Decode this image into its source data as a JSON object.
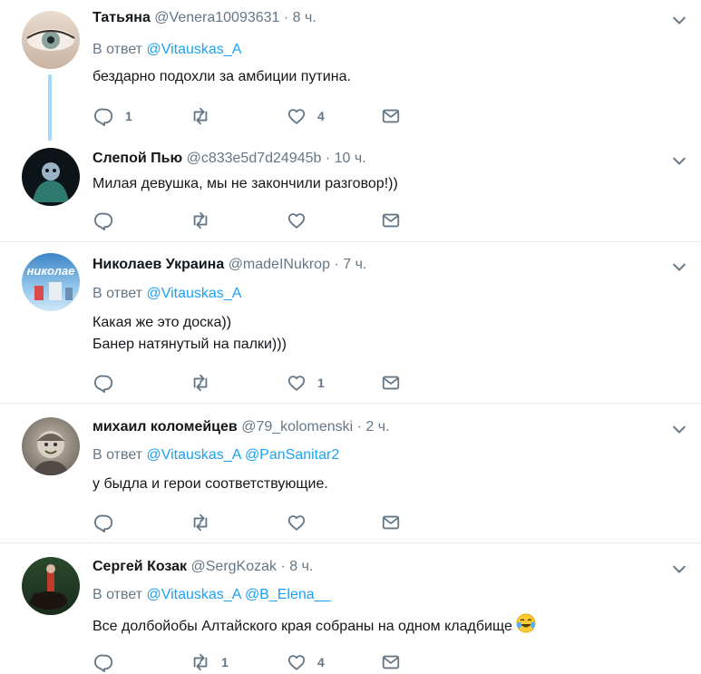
{
  "tweets": [
    {
      "name": "Татьяна",
      "handle": "@Venera10093631",
      "dot": "·",
      "time": "8 ч.",
      "reply_prefix": "В ответ",
      "mentions": [
        "@Vitauskas_A"
      ],
      "lines": [
        "бездарно подохли за амбиции путина."
      ],
      "replies": "1",
      "retweets": "",
      "likes": "4"
    },
    {
      "name": "Слепой Пью",
      "handle": "@c833e5d7d24945b",
      "dot": "·",
      "time": "10 ч.",
      "lines": [
        "Милая девушка, мы не закончили разговор!))"
      ],
      "replies": "",
      "retweets": "",
      "likes": ""
    },
    {
      "name": "Николаев Украина",
      "handle": "@madeINukrop",
      "dot": "·",
      "time": "7 ч.",
      "reply_prefix": "В ответ",
      "mentions": [
        "@Vitauskas_A"
      ],
      "lines": [
        "Какая же это доска))",
        "Банер натянутый на палки)))"
      ],
      "replies": "",
      "retweets": "",
      "likes": "1"
    },
    {
      "name": "михаил коломейцев",
      "handle": "@79_kolomenski",
      "dot": "·",
      "time": "2 ч.",
      "reply_prefix": "В ответ",
      "mentions": [
        "@Vitauskas_A",
        "@PanSanitar2"
      ],
      "lines": [
        "у быдла и герои соответствующие."
      ],
      "replies": "",
      "retweets": "",
      "likes": ""
    },
    {
      "name": "Сергей Козак",
      "handle": "@SergKozak",
      "dot": "·",
      "time": "8 ч.",
      "reply_prefix": "В ответ",
      "mentions": [
        "@Vitauskas_A",
        "@B_Elena__"
      ],
      "lines": [
        "Все долбойобы Алтайского края собраны на одном кладбище"
      ],
      "replies": "",
      "retweets": "1",
      "likes": "4"
    }
  ],
  "colors": {
    "accent": "#1da1f2",
    "muted": "#657786",
    "thread_line": "#a4d9f5",
    "divider": "#e6ecf0"
  },
  "icons": [
    "chevron-down-icon",
    "reply-icon",
    "retweet-icon",
    "like-icon",
    "direct-message-icon",
    "tears-of-joy-emoji"
  ]
}
